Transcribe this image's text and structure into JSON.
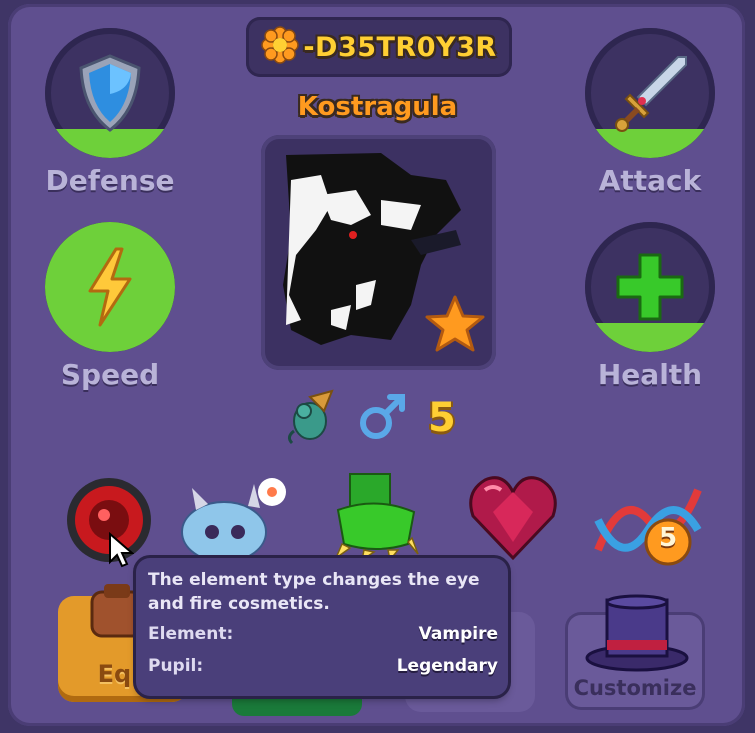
{
  "monster": {
    "name": "-D35TR0Y3R",
    "species": "Kostragula",
    "level": "5"
  },
  "stats": {
    "defense": {
      "label": "Defense",
      "fill": 0.22
    },
    "attack": {
      "label": "Attack",
      "fill": 0.22
    },
    "speed": {
      "label": "Speed",
      "fill": 1.0
    },
    "health": {
      "label": "Health",
      "fill": 0.22
    }
  },
  "icons": {
    "name_badge": "orange-flower-icon",
    "defense": "shield-icon",
    "attack": "sword-icon",
    "speed": "lightning-icon",
    "health": "plus-icon",
    "favorite": "star-icon",
    "family": "dragon-icon",
    "gender": "male-icon"
  },
  "cosmetics": {
    "eye": "red-eye-icon",
    "pet": "blue-creature-icon",
    "claw": "green-claw-icon",
    "heart": "crimson-heart-icon",
    "dna": "dna-icon",
    "dna_badge": "5"
  },
  "buttons": {
    "equip": "Equ",
    "customize": "Customize"
  },
  "tooltip": {
    "description": "The element type changes the eye and fire cosmetics.",
    "element_label": "Element:",
    "element_value": "Vampire",
    "pupil_label": "Pupil:",
    "pupil_value": "Legendary"
  },
  "colors": {
    "panel": "#5f4f8f",
    "name": "#ffcf33",
    "species": "#ff9a1f",
    "stat_fill": "#6ed03a"
  }
}
